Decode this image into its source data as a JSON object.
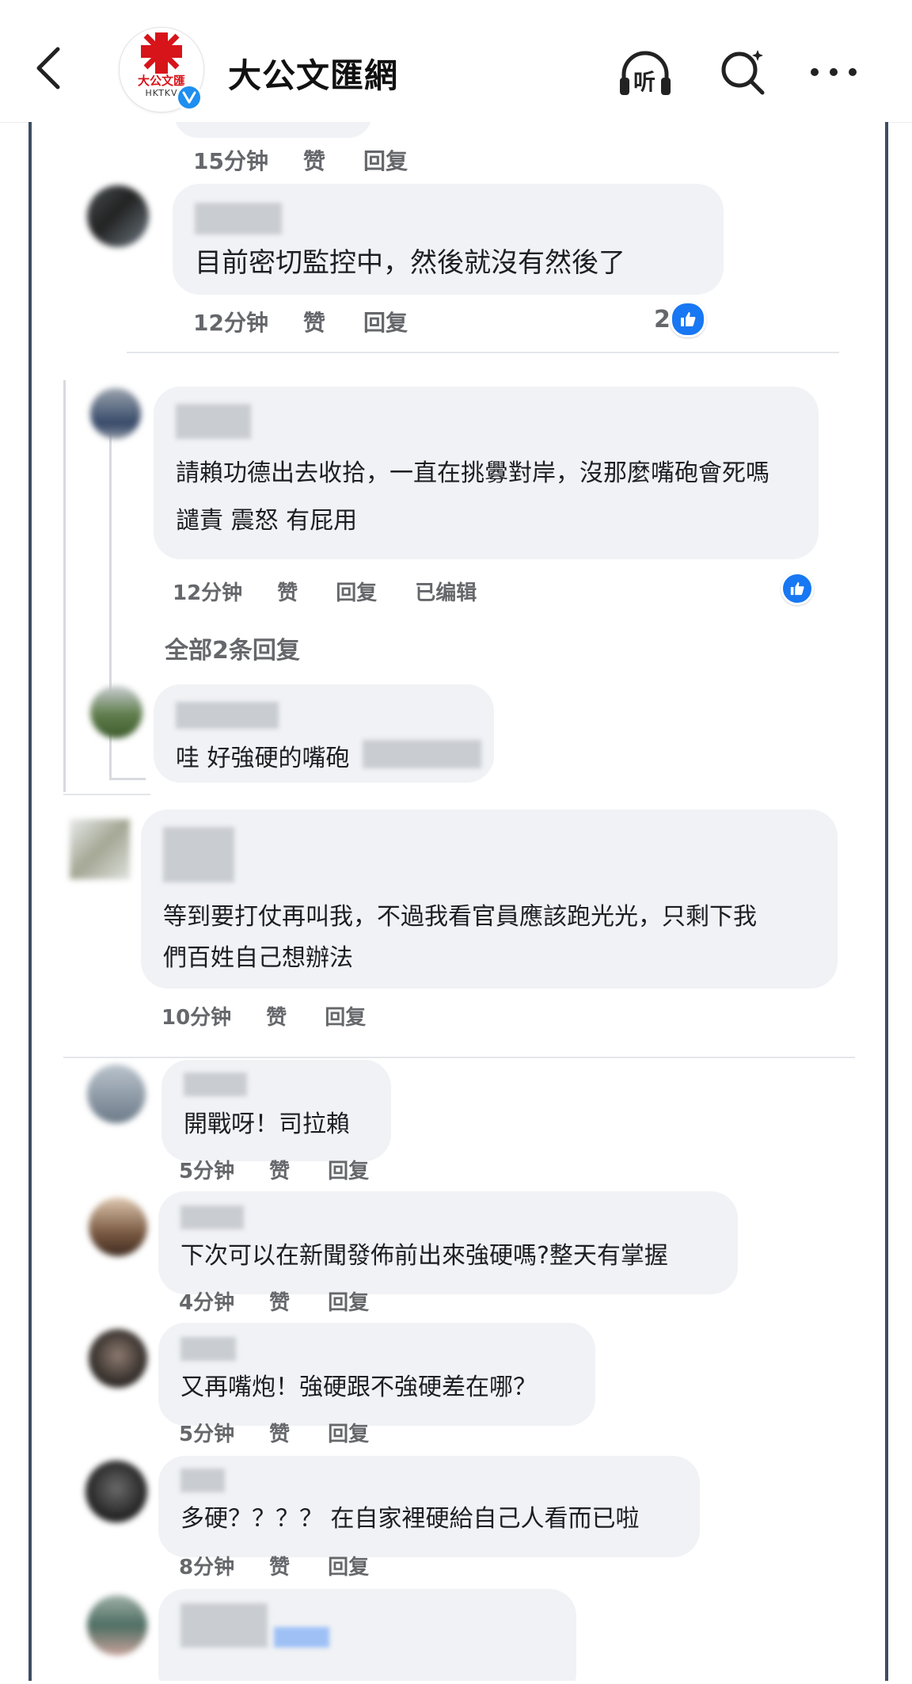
{
  "header": {
    "account_name": "大公文匯網",
    "logo_text_cn": "大公文匯",
    "logo_text_en": "HKTKV",
    "listen_label": "听"
  },
  "comments": [
    {
      "id": "c0",
      "text": "",
      "time": "15分钟",
      "like": "赞",
      "reply": "回复"
    },
    {
      "id": "c1",
      "text": "目前密切監控中，然後就沒有然後了",
      "time": "12分钟",
      "like": "赞",
      "reply": "回复",
      "reactions": "2"
    },
    {
      "id": "c2",
      "lines": [
        "請賴功德出去收拾，一直在挑釁對岸，沒那麼嘴砲會死嗎",
        "譴責 震怒 有屁用"
      ],
      "time": "12分钟",
      "like": "赞",
      "reply": "回复",
      "edited": "已编辑"
    },
    {
      "id": "c3",
      "text": "哇 好強硬的嘴砲",
      "view_all_replies": "全部2条回复"
    },
    {
      "id": "c4",
      "lines": [
        "等到要打仗再叫我，不過我看官員應該跑光光，只剩下我",
        "們百姓自己想辦法"
      ],
      "time": "10分钟",
      "like": "赞",
      "reply": "回复"
    },
    {
      "id": "c5",
      "text": "開戰呀！司拉賴",
      "time": "5分钟",
      "like": "赞",
      "reply": "回复"
    },
    {
      "id": "c6",
      "text": "下次可以在新聞發佈前出來強硬嗎?整天有掌握",
      "time": "4分钟",
      "like": "赞",
      "reply": "回复"
    },
    {
      "id": "c7",
      "text": "又再嘴炮！強硬跟不強硬差在哪？",
      "time": "5分钟",
      "like": "赞",
      "reply": "回复"
    },
    {
      "id": "c8",
      "text": "多硬？？？？ 在自家裡硬給自己人看而已啦",
      "time": "8分钟",
      "like": "赞",
      "reply": "回复"
    }
  ],
  "colors": {
    "like_blue": "#1877f2",
    "bubble": "#f0f2f5",
    "meta": "#65676b",
    "frame": "#3d4d63",
    "verified": "#1e8ef0",
    "logo_red": "#d7141a"
  }
}
